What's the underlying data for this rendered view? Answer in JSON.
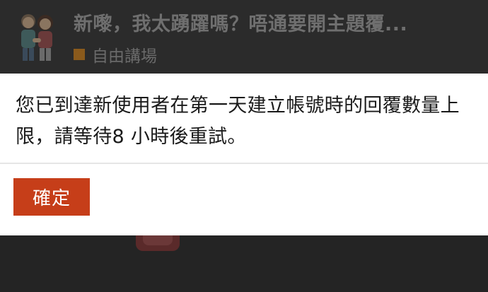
{
  "topic": {
    "title": "新嚟，我太踴躍嗎？唔通要開主題覆...",
    "category": "自由講場",
    "category_color": "#e07a00",
    "avatar_icon": "couple-avatar-icon"
  },
  "dialog": {
    "message": "您已到達新使用者在第一天建立帳號時的回覆數量上限，請等待8 小時後重試。",
    "ok_label": "確定",
    "ok_color": "#c63e19"
  }
}
